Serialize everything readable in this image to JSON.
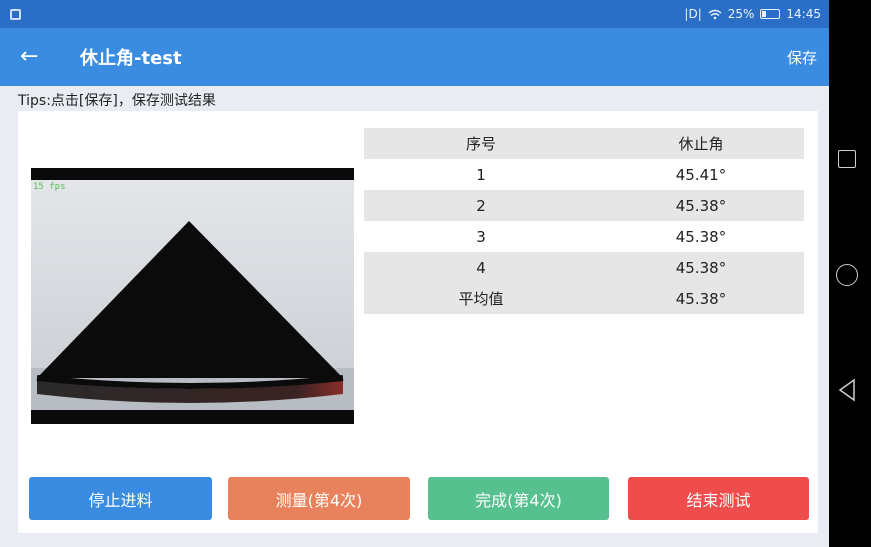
{
  "status_bar": {
    "battery": "25%",
    "time": "14:45",
    "signal_text": "|D|",
    "icons": [
      "app-notification-icon",
      "vibrate-icon",
      "wifi-icon",
      "battery-icon"
    ]
  },
  "app_bar": {
    "back_icon": "←",
    "title": "休止角-test",
    "save_label": "保存"
  },
  "tips": "Tips:点击[保存]，保存测试结果",
  "camera": {
    "fps": "15 fps"
  },
  "table": {
    "headers": [
      "序号",
      "休止角"
    ],
    "rows": [
      [
        "1",
        "45.41°"
      ],
      [
        "2",
        "45.38°"
      ],
      [
        "3",
        "45.38°"
      ],
      [
        "4",
        "45.38°"
      ],
      [
        "平均值",
        "45.38°"
      ]
    ]
  },
  "buttons": {
    "stop_feed": "停止进料",
    "measure": "测量(第4次)",
    "done": "完成(第4次)",
    "end_test": "结束测试"
  },
  "colors": {
    "status_bar": "#2a6fc5",
    "app_bar": "#3a8ce0",
    "stop_button": "#3a8ce0",
    "measure_button": "#e8825c",
    "done_button": "#56c08f",
    "end_button": "#ef4c4c"
  },
  "nav_bar": {
    "icons": [
      "recent-apps-square-icon",
      "home-circle-icon",
      "back-triangle-icon"
    ]
  }
}
